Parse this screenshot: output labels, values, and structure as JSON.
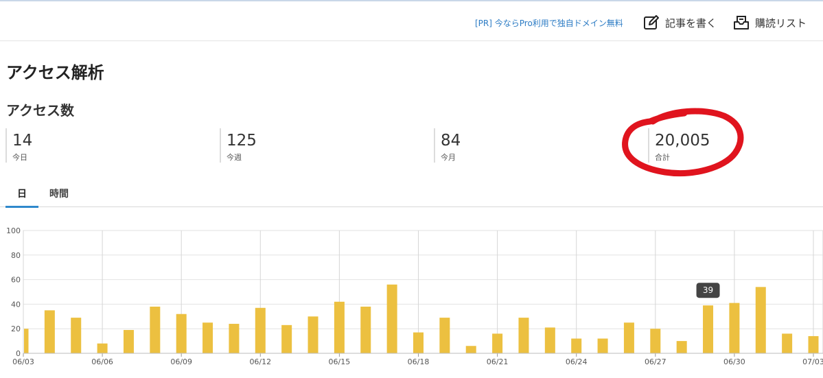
{
  "header": {
    "pr_link": "[PR] 今ならPro利用で独自ドメイン無料",
    "write_label": "記事を書く",
    "subscribe_label": "購読リスト"
  },
  "page": {
    "title": "アクセス解析",
    "section_title": "アクセス数"
  },
  "stats": {
    "today": {
      "value": "14",
      "label": "今日"
    },
    "week": {
      "value": "125",
      "label": "今週"
    },
    "month": {
      "value": "84",
      "label": "今月"
    },
    "total": {
      "value": "20,005",
      "label": "合計"
    }
  },
  "tabs": {
    "day": "日",
    "hour": "時間",
    "active": "day"
  },
  "tooltip": {
    "text": "39",
    "index": 26
  },
  "colors": {
    "bar": "#ecc040",
    "accent": "#2f88cc",
    "annotation": "#e0141e",
    "link": "#2b7bc4",
    "tooltip_bg": "#444444"
  },
  "chart_data": {
    "type": "bar",
    "ylim": [
      0,
      100
    ],
    "yticks": [
      0,
      20,
      40,
      60,
      80,
      100
    ],
    "grid": true,
    "categories": [
      "06/03",
      "06/04",
      "06/05",
      "06/06",
      "06/07",
      "06/08",
      "06/09",
      "06/10",
      "06/11",
      "06/12",
      "06/13",
      "06/14",
      "06/15",
      "06/16",
      "06/17",
      "06/18",
      "06/19",
      "06/20",
      "06/21",
      "06/22",
      "06/23",
      "06/24",
      "06/25",
      "06/26",
      "06/27",
      "06/28",
      "06/29",
      "06/30",
      "07/01",
      "07/02",
      "07/03"
    ],
    "values": [
      20,
      35,
      29,
      8,
      19,
      38,
      32,
      25,
      24,
      37,
      23,
      30,
      42,
      38,
      56,
      17,
      29,
      6,
      16,
      29,
      21,
      12,
      12,
      25,
      20,
      10,
      39,
      41,
      54,
      16,
      14
    ],
    "xtick_labels": [
      "06/03",
      "06/06",
      "06/09",
      "06/12",
      "06/15",
      "06/18",
      "06/21",
      "06/24",
      "06/27",
      "06/30",
      "07/03"
    ]
  }
}
